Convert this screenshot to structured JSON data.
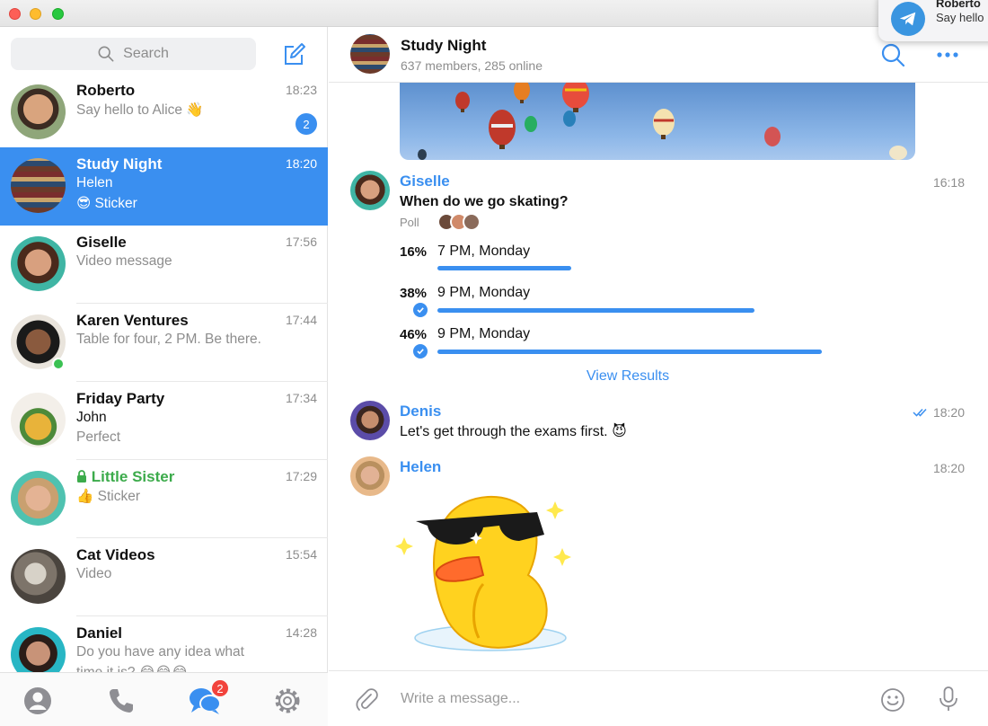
{
  "window": {
    "title": ""
  },
  "notification": {
    "title": "Roberto",
    "text": "Say hello"
  },
  "sidebar": {
    "search_placeholder": "Search",
    "chats": [
      {
        "name": "Roberto",
        "time": "18:23",
        "line1": "Say hello to Alice 👋",
        "line2": "",
        "badge": "2",
        "active": false
      },
      {
        "name": "Study Night",
        "time": "18:20",
        "line1": "Helen",
        "line2": "😎 Sticker",
        "badge": "",
        "active": true
      },
      {
        "name": "Giselle",
        "time": "17:56",
        "line1": "Video message",
        "line2": "",
        "badge": "",
        "active": false
      },
      {
        "name": "Karen Ventures",
        "time": "17:44",
        "line1": "Table for four, 2 PM. Be there.",
        "line2": "",
        "badge": "",
        "active": false,
        "online": true
      },
      {
        "name": "Friday Party",
        "time": "17:34",
        "line1": "John",
        "line2": "Perfect",
        "badge": "",
        "active": false
      },
      {
        "name": "Little Sister",
        "time": "17:29",
        "line1": "👍 Sticker",
        "line2": "",
        "badge": "",
        "active": false,
        "secret": true
      },
      {
        "name": "Cat Videos",
        "time": "15:54",
        "line1": "Video",
        "line2": "",
        "badge": "",
        "active": false
      },
      {
        "name": "Daniel",
        "time": "14:28",
        "line1": "Do you have any idea what",
        "line2": "time it is? 😂😂😂",
        "badge": "",
        "active": false
      }
    ],
    "tabs": {
      "chats_badge": "2"
    }
  },
  "header": {
    "title": "Study Night",
    "subtitle": "637 members, 285 online"
  },
  "messages": {
    "giselle": {
      "sender": "Giselle",
      "time": "16:18"
    },
    "poll": {
      "question": "When do we go skating?",
      "label": "Poll",
      "options": [
        {
          "percent": "16%",
          "text": "7 PM, Monday",
          "value": 16,
          "checked": false
        },
        {
          "percent": "38%",
          "text": "9 PM, Monday",
          "value": 38,
          "checked": true
        },
        {
          "percent": "46%",
          "text": "9 PM, Monday",
          "value": 46,
          "checked": true
        }
      ],
      "view_results": "View Results"
    },
    "denis": {
      "sender": "Denis",
      "time": "18:20",
      "text": "Let's get through the exams first. 😈"
    },
    "helen": {
      "sender": "Helen",
      "time": "18:20"
    }
  },
  "composer": {
    "placeholder": "Write a message..."
  },
  "colors": {
    "accent": "#3a8ff0",
    "online": "#3bc152",
    "badge_red": "#f2433c",
    "secret_green": "#3cab4b"
  }
}
